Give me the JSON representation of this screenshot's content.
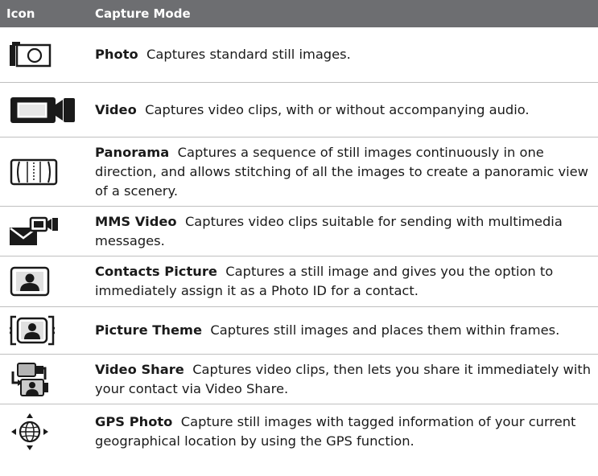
{
  "header": {
    "icon_col": "Icon",
    "mode_col": "Capture Mode"
  },
  "rows": [
    {
      "icon": "camera-icon",
      "name": "Photo",
      "desc": "Captures standard still images."
    },
    {
      "icon": "video-camera-icon",
      "name": "Video",
      "desc": "Captures video clips, with or without accompanying audio."
    },
    {
      "icon": "panorama-icon",
      "name": "Panorama",
      "desc": "Captures a sequence of still images continuously in one direction, and allows stitching of all the images to create a panoramic view of a scenery."
    },
    {
      "icon": "mms-video-icon",
      "name": "MMS Video",
      "desc": "Captures video clips suitable for sending with multimedia messages."
    },
    {
      "icon": "contact-picture-icon",
      "name": "Contacts Picture",
      "desc": "Captures a still image and gives you the option to immediately assign it as a Photo ID for a contact."
    },
    {
      "icon": "picture-theme-icon",
      "name": "Picture Theme",
      "desc": "Captures still images and places them within frames."
    },
    {
      "icon": "video-share-icon",
      "name": "Video Share",
      "desc": "Captures video clips, then lets you share it immediately with your contact via Video Share."
    },
    {
      "icon": "gps-globe-icon",
      "name": "GPS Photo",
      "desc": "Capture still images with tagged information of your current geographical location by using the GPS function."
    }
  ]
}
